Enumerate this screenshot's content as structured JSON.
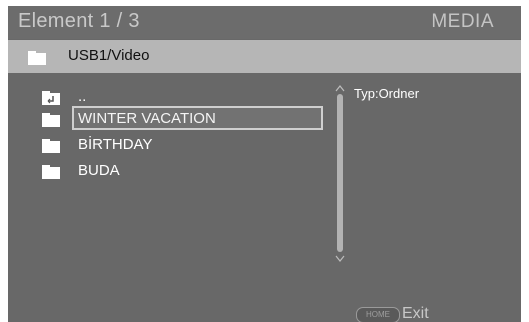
{
  "header": {
    "title": "Element 1 / 3",
    "mode": "MEDIA"
  },
  "path": {
    "label": "USB1/Video",
    "icon": "folder-icon"
  },
  "items": [
    {
      "label": "..",
      "icon": "parent-folder-icon"
    },
    {
      "label": "WINTER VACATION",
      "icon": "folder-icon",
      "selected": true
    },
    {
      "label": "BİRTHDAY",
      "icon": "folder-icon"
    },
    {
      "label": "BUDA",
      "icon": "folder-icon"
    }
  ],
  "info": {
    "type_text": "Typ:Ordner"
  },
  "footer": {
    "home_button_label": "HOME",
    "exit_label": "Exit"
  },
  "colors": {
    "background": "#686868",
    "path_bar": "#b6b6b6",
    "text": "#ffffff"
  }
}
